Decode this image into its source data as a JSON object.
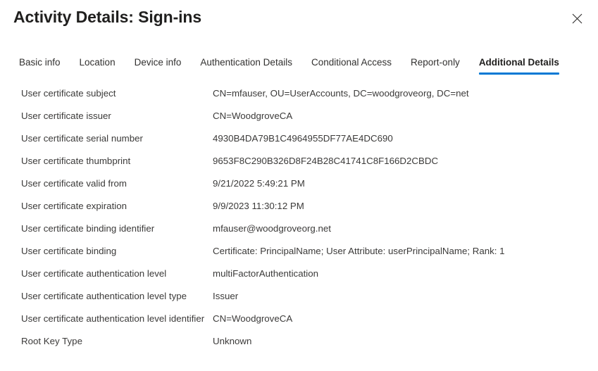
{
  "header": {
    "title": "Activity Details: Sign-ins",
    "close_icon": "close-icon"
  },
  "tabs": [
    {
      "label": "Basic info",
      "active": false
    },
    {
      "label": "Location",
      "active": false
    },
    {
      "label": "Device info",
      "active": false
    },
    {
      "label": "Authentication Details",
      "active": false
    },
    {
      "label": "Conditional Access",
      "active": false
    },
    {
      "label": "Report-only",
      "active": false
    },
    {
      "label": "Additional Details",
      "active": true
    }
  ],
  "colors": {
    "accent": "#0078d4",
    "text": "#323130",
    "secondary_text": "#3b3a39",
    "background": "#ffffff"
  },
  "details": [
    {
      "label": "User certificate subject",
      "value": "CN=mfauser, OU=UserAccounts, DC=woodgroveorg, DC=net"
    },
    {
      "label": "User certificate issuer",
      "value": "CN=WoodgroveCA"
    },
    {
      "label": "User certificate serial number",
      "value": "4930B4DA79B1C4964955DF77AE4DC690"
    },
    {
      "label": "User certificate thumbprint",
      "value": "9653F8C290B326D8F24B28C41741C8F166D2CBDC"
    },
    {
      "label": "User certificate valid from",
      "value": "9/21/2022 5:49:21 PM"
    },
    {
      "label": "User certificate expiration",
      "value": "9/9/2023 11:30:12 PM"
    },
    {
      "label": "User certificate binding identifier",
      "value": "mfauser@woodgroveorg.net"
    },
    {
      "label": "User certificate binding",
      "value": "Certificate: PrincipalName; User Attribute: userPrincipalName; Rank: 1"
    },
    {
      "label": "User certificate authentication level",
      "value": "multiFactorAuthentication"
    },
    {
      "label": "User certificate authentication level type",
      "value": "Issuer"
    },
    {
      "label": "User certificate authentication level identifier",
      "value": "CN=WoodgroveCA"
    },
    {
      "label": "Root Key Type",
      "value": "Unknown"
    }
  ]
}
